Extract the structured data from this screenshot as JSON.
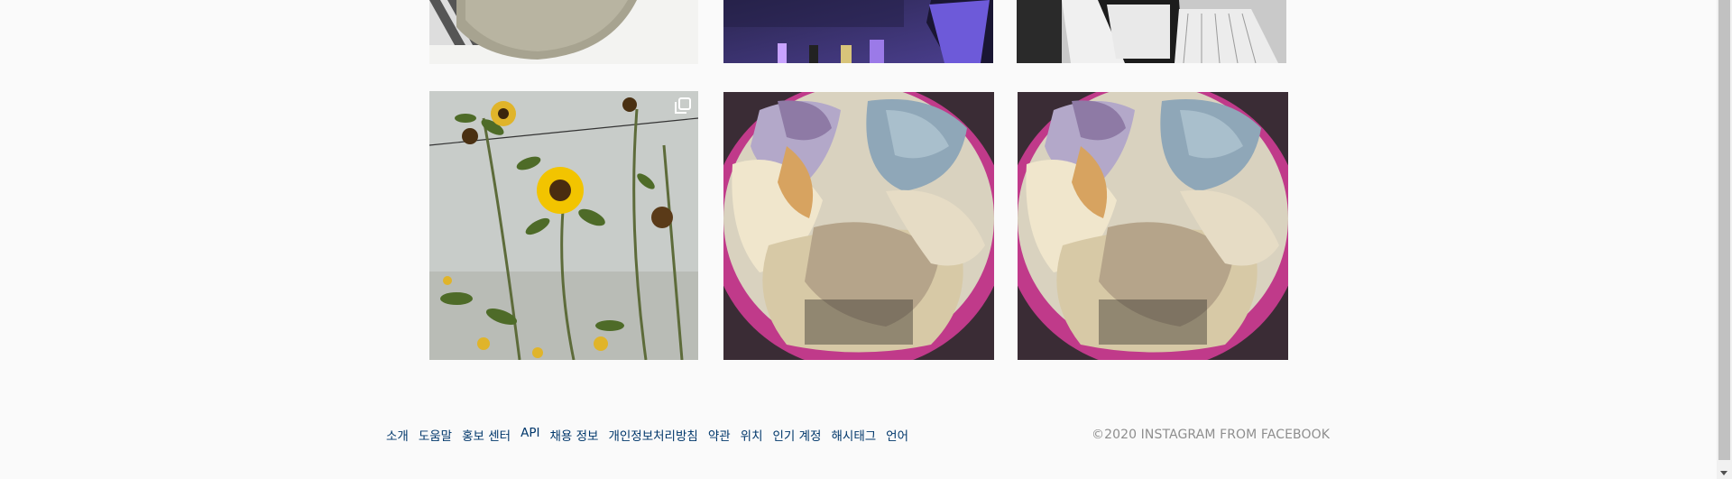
{
  "footer": {
    "links": [
      "소개",
      "도움말",
      "홍보 센터",
      "API",
      "채용 정보",
      "개인정보처리방침",
      "약관",
      "위치",
      "인기 계정",
      "해시태그",
      "언어"
    ],
    "copyright": "©2020 INSTAGRAM FROM FACEBOOK"
  },
  "posts": [
    {
      "subject": "gray-fabric-plate"
    },
    {
      "subject": "phone-product-display"
    },
    {
      "subject": "black-and-white-fashion"
    },
    {
      "subject": "sunflowers",
      "multi_icon": "multiple-photos-icon"
    },
    {
      "subject": "ice-cream-tub"
    },
    {
      "subject": "ice-cream-tub"
    }
  ],
  "colors": {
    "background": "#fafafa",
    "link": "#00376b",
    "muted": "#8e8e8e"
  }
}
